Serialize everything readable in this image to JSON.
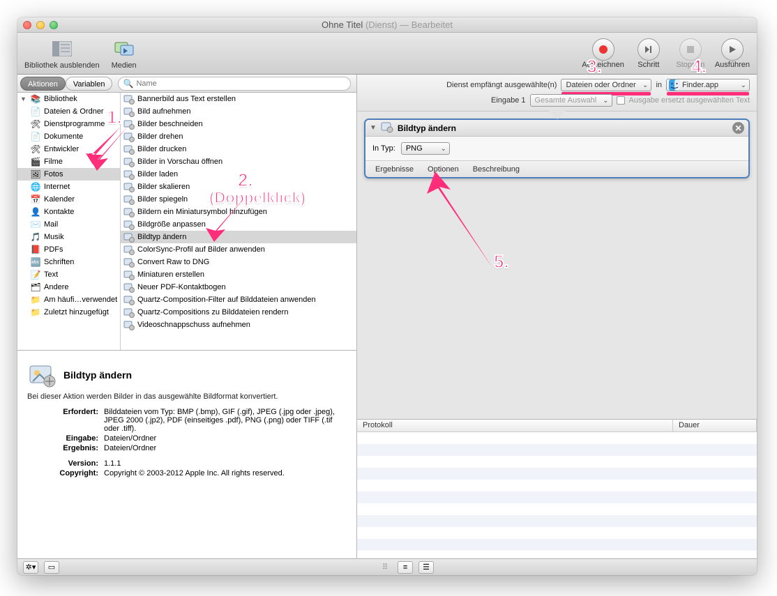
{
  "title": {
    "main": "Ohne Titel",
    "suffix": "(Dienst)",
    "sep": " — ",
    "state": "Bearbeitet"
  },
  "toolbar": {
    "hideLib": "Bibliothek ausblenden",
    "media": "Medien",
    "record": "Aufzeichnen",
    "step": "Schritt",
    "stop": "Stoppen",
    "run": "Ausführen"
  },
  "tabs": {
    "actions": "Aktionen",
    "vars": "Variablen"
  },
  "search": {
    "placeholder": "Name"
  },
  "library": {
    "root": "Bibliothek",
    "items": [
      "Dateien & Ordner",
      "Dienstprogramme",
      "Dokumente",
      "Entwickler",
      "Filme",
      "Fotos",
      "Internet",
      "Kalender",
      "Kontakte",
      "Mail",
      "Musik",
      "PDFs",
      "Schriften",
      "Text",
      "Andere"
    ],
    "recent": "Am häufi…verwendet",
    "last": "Zuletzt hinzugefügt"
  },
  "actions": [
    "Bannerbild aus Text erstellen",
    "Bild aufnehmen",
    "Bilder beschneiden",
    "Bilder drehen",
    "Bilder drucken",
    "Bilder in Vorschau öffnen",
    "Bilder laden",
    "Bilder skalieren",
    "Bilder spiegeln",
    "Bildern ein Miniatursymbol hinzufügen",
    "Bildgröße anpassen",
    "Bildtyp ändern",
    "ColorSync-Profil auf Bilder anwenden",
    "Convert Raw to DNG",
    "Miniaturen erstellen",
    "Neuer PDF-Kontaktbogen",
    "Quartz-Composition-Filter auf Bilddateien anwenden",
    "Quartz-Compositions zu Bilddateien rendern",
    "Videoschnappschuss aufnehmen"
  ],
  "selectedActionIndex": 11,
  "info": {
    "title": "Bildtyp ändern",
    "desc": "Bei dieser Aktion werden Bilder in das ausgewählte Bildformat konvertiert.",
    "rows": {
      "Erfordert": "Bilddateien vom Typ: BMP (.bmp), GIF (.gif), JPEG (.jpg oder .jpeg), JPEG 2000 (.jp2), PDF (einseitiges .pdf), PNG (.png) oder TIFF (.tif oder .tiff).",
      "Eingabe": "Dateien/Ordner",
      "Ergebnis": "Dateien/Ordner",
      "Version": "1.1.1",
      "Copyright": "Copyright © 2003-2012 Apple Inc.  All rights reserved."
    }
  },
  "service": {
    "label1": "Dienst empfängt ausgewählte(n)",
    "receives": "Dateien oder Ordner",
    "inWord": "in",
    "app": "Finder.app",
    "label2": "Eingabe 1",
    "selection": "Gesamte Auswahl",
    "replace": "Ausgabe ersetzt ausgewählten Text"
  },
  "card": {
    "title": "Bildtyp ändern",
    "typeLabel": "In Typ:",
    "type": "PNG",
    "tabs": {
      "result": "Ergebnisse",
      "options": "Optionen",
      "desc": "Beschreibung"
    }
  },
  "log": {
    "col1": "Protokoll",
    "col2": "Dauer"
  },
  "annotations": {
    "n1": "1.",
    "n2": "2.",
    "n2b": "(Doppelklick)",
    "n3": "3.",
    "n4": "4.",
    "n5": "5."
  }
}
